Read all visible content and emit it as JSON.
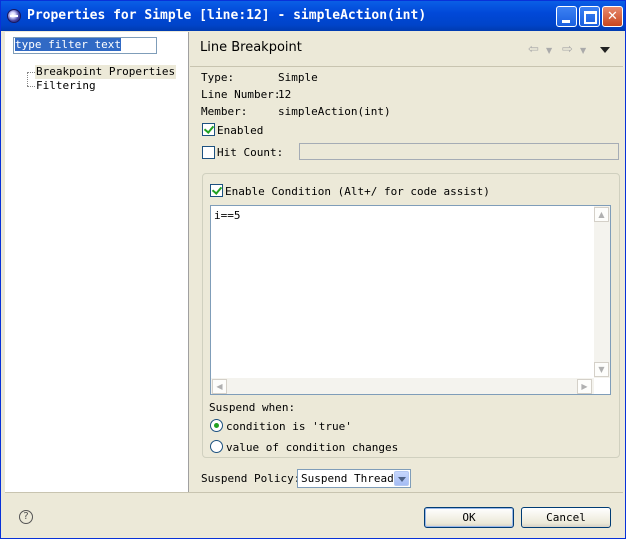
{
  "window": {
    "title": "Properties for Simple [line:12] - simpleAction(int)"
  },
  "left": {
    "filter_value": "type filter text",
    "tree": [
      "Breakpoint Properties",
      "Filtering"
    ]
  },
  "header": {
    "title": "Line Breakpoint"
  },
  "info": {
    "type_label": "Type:",
    "type_value": "Simple",
    "line_label": "Line Number:",
    "line_value": "12",
    "member_label": "Member:",
    "member_value": "simpleAction(int)"
  },
  "options": {
    "enabled_label": "Enabled",
    "enabled_checked": true,
    "hit_count_label": "Hit Count:",
    "hit_count_checked": false,
    "hit_count_value": ""
  },
  "condition": {
    "enable_label": "Enable Condition (Alt+/ for code assist)",
    "enable_checked": true,
    "text": "i==5",
    "suspend_when_label": "Suspend when:",
    "radio_true_label": "condition is 'true'",
    "radio_changes_label": "value of condition changes",
    "selected": "condition is 'true'"
  },
  "policy": {
    "label": "Suspend Policy:",
    "value": "Suspend Thread"
  },
  "buttons": {
    "ok": "OK",
    "cancel": "Cancel"
  },
  "icons": {
    "window": "eclipse-icon",
    "help": "help-icon"
  },
  "colors": {
    "title_bar": "#0148d8",
    "check_accent": "#21a121"
  }
}
